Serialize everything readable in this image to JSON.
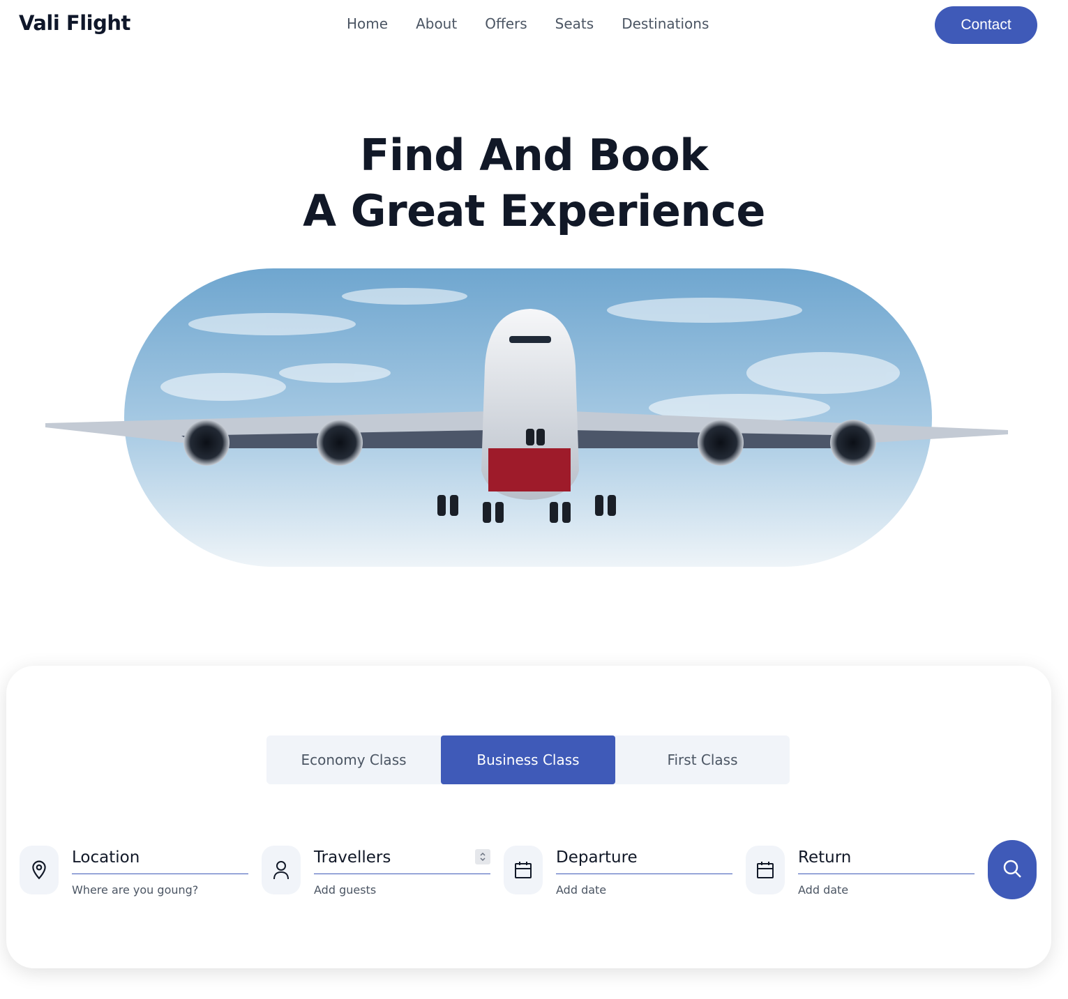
{
  "header": {
    "logo": "Vali Flight",
    "nav": [
      "Home",
      "About",
      "Offers",
      "Seats",
      "Destinations"
    ],
    "contact_label": "Contact"
  },
  "hero": {
    "line1": "Find And Book",
    "line2": "A Great Experience"
  },
  "search": {
    "classes": [
      "Economy Class",
      "Business Class",
      "First Class"
    ],
    "active_class": "Business Class",
    "fields": {
      "location": {
        "label": "Location",
        "hint": "Where are you goung?",
        "icon": "map-pin-icon"
      },
      "travellers": {
        "label": "Travellers",
        "hint": "Add guests",
        "icon": "user-icon"
      },
      "departure": {
        "label": "Departure",
        "hint": "Add date",
        "icon": "calendar-icon"
      },
      "return": {
        "label": "Return",
        "hint": "Add date",
        "icon": "calendar-icon"
      }
    }
  },
  "colors": {
    "accent": "#3f5ab8",
    "field_bg": "#f1f4f9",
    "heading": "#111827",
    "muted": "#4b5563"
  }
}
